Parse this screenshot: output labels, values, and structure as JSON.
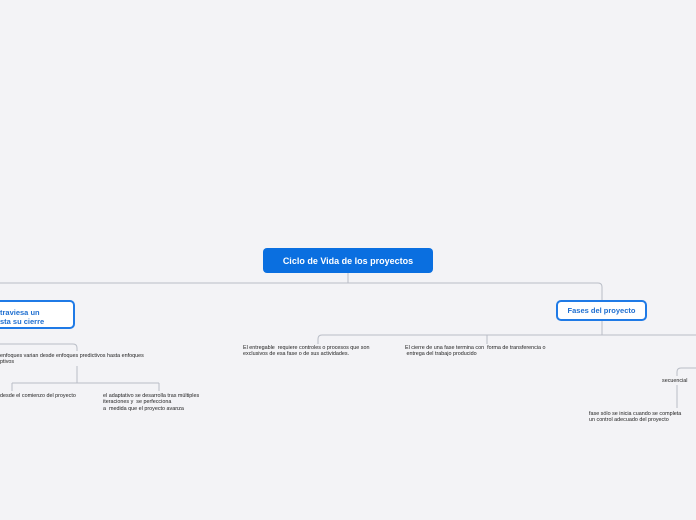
{
  "map": {
    "root": "Ciclo de Vida de los proyectos",
    "left_branch": {
      "line1": "traviesa un",
      "line2": "sta su cierre",
      "sub": {
        "line1": "enfoques varian desde enfoques predictivos hasta enfoques",
        "line2": "ptivos"
      },
      "leaf_a": "desde el comienzo del proyecto",
      "leaf_b": {
        "line1": "el adaptativo se desarrolla tras múltiples",
        "line2": "iteraciones y  se perfecciona",
        "line3": "a  medida que el proyecto avanza"
      }
    },
    "right_branch": {
      "title": "Fases del proyecto",
      "child_1": {
        "line1": "El entregable  requiere controles o procesos que son",
        "line2": "exclusivos de esa fase o de sus actividades."
      },
      "child_2": {
        "line1": "El cierre de una fase termina con  forma de transferencia o",
        "line2": " entrega del trabajo producido"
      },
      "child_3": "secuencial",
      "child_3_leaf": {
        "line1": "fase sólo se inicia cuando se completa",
        "line2": "un control adecuado del proyecto"
      }
    }
  },
  "colors": {
    "background": "#f3f3f6",
    "root_fill": "#0a6fe0",
    "branch_border": "#1f7ae6",
    "connector": "#b9bdc6"
  }
}
